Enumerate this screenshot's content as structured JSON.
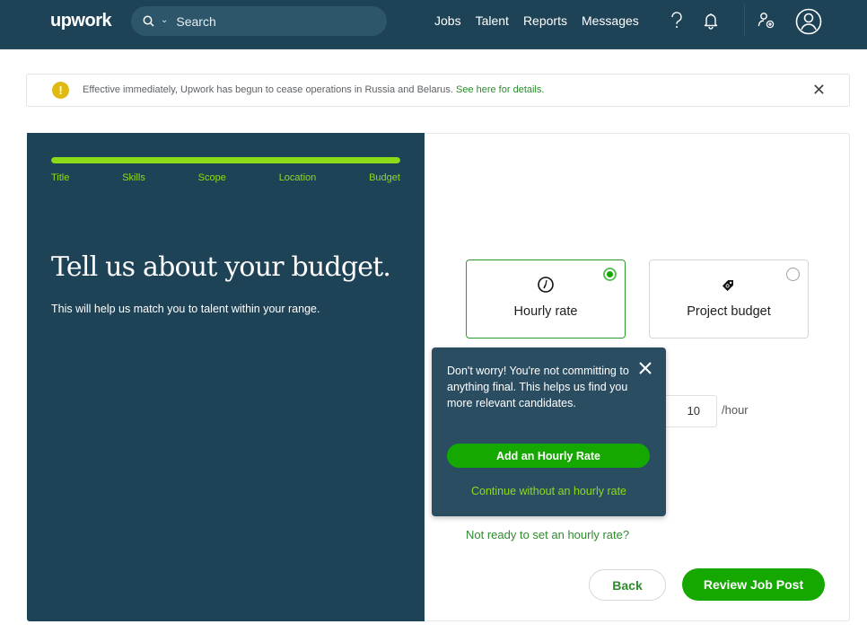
{
  "nav": {
    "logo": "upwork",
    "search_placeholder": "Search",
    "links": [
      "Jobs",
      "Talent",
      "Reports",
      "Messages"
    ],
    "icons": [
      "help-icon",
      "bell-icon",
      "add-user-icon",
      "avatar-icon"
    ]
  },
  "banner": {
    "icon": "warning-icon",
    "message": "Effective immediately, Upwork has begun to cease operations in Russia and Belarus. ",
    "link": "See here for details.",
    "close_icon": "close-icon"
  },
  "left": {
    "progress": {
      "steps": [
        "Title",
        "Skills",
        "Scope",
        "Location",
        "Budget"
      ],
      "current_step": 5,
      "total_steps": 5,
      "fill_fraction": 1.0
    },
    "headline": "Tell us about your budget.",
    "subline": "This will help us match you to talent within your range."
  },
  "budget": {
    "options": [
      {
        "label": "Hourly rate",
        "icon": "clock-icon",
        "selected": true
      },
      {
        "label": "Project budget",
        "icon": "price-tag-icon",
        "selected": false
      }
    ],
    "rate_value": "10",
    "rate_unit": "/hour",
    "not_ready_link": "Not ready to set an hourly rate?"
  },
  "popover": {
    "text": "Don't worry! You're not committing to anything final. This helps us find you more relevant candidates.",
    "primary": "Add an Hourly Rate",
    "secondary": "Continue without an hourly rate"
  },
  "footer": {
    "back": "Back",
    "review": "Review Job Post"
  },
  "colors": {
    "brand_green": "#14a800",
    "accent_lime": "#8cdb19",
    "navy": "#1f4356",
    "link_green": "#2e8b2e"
  }
}
